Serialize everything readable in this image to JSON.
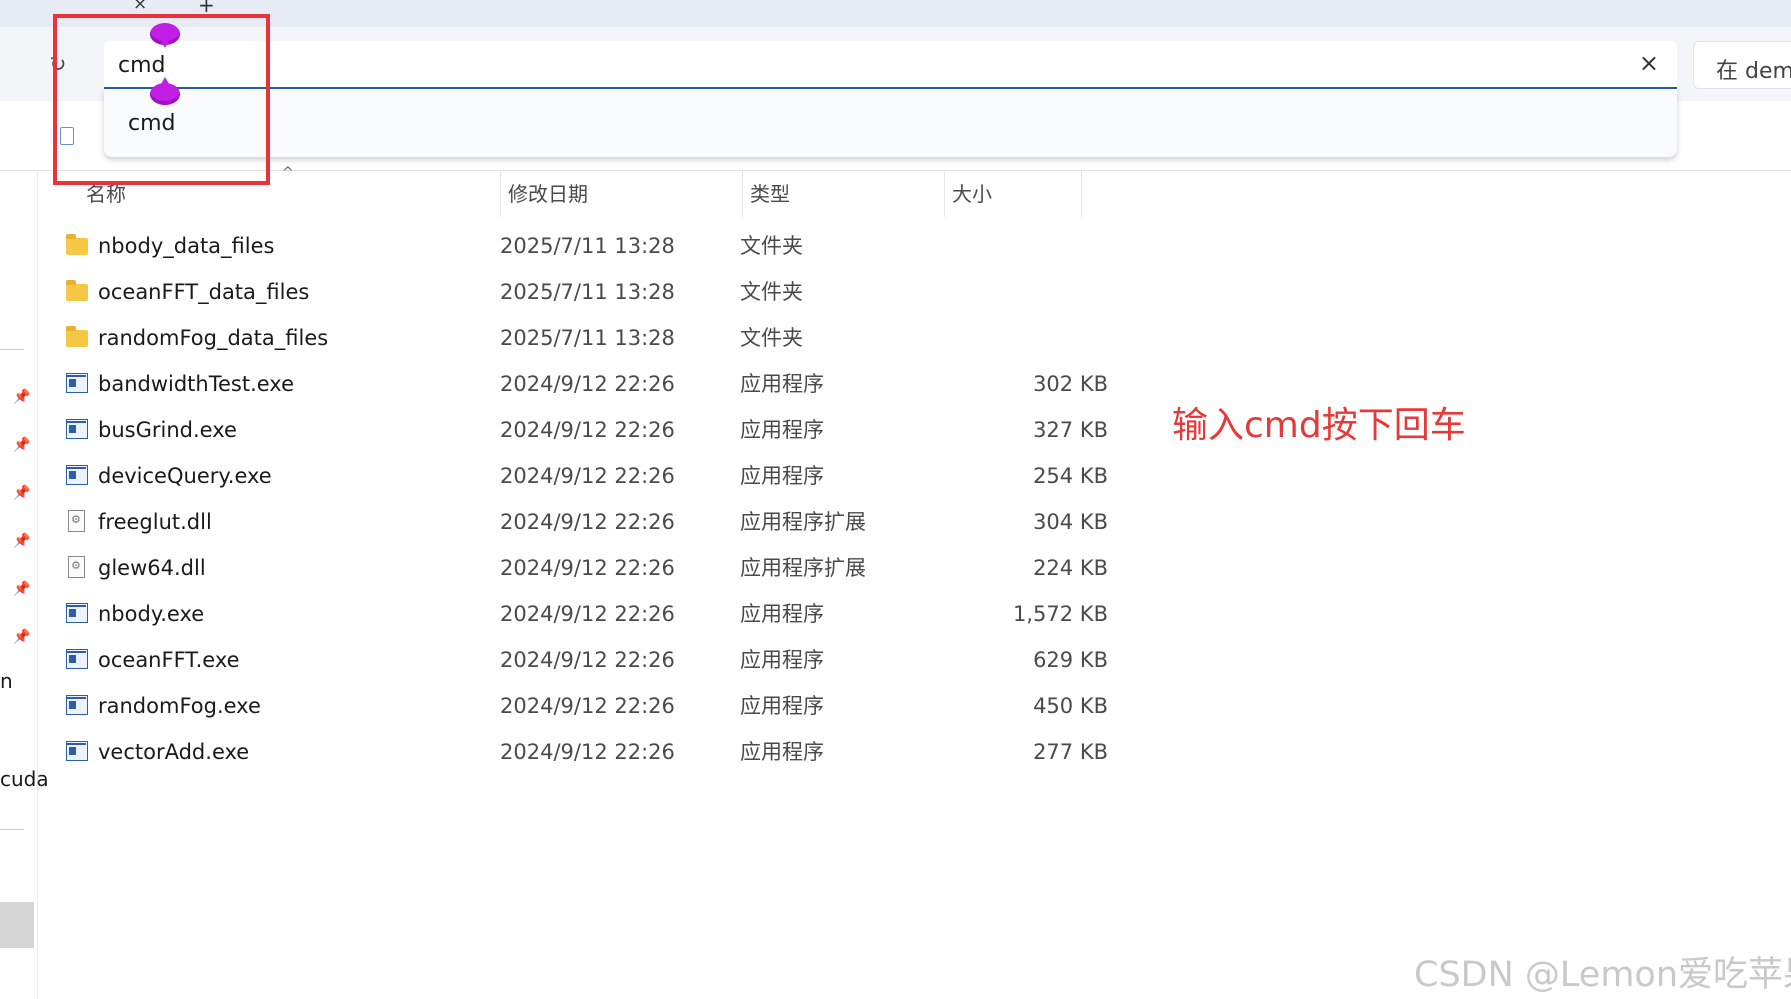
{
  "titlebar": {
    "close_glyph": "×",
    "add_glyph": "+"
  },
  "toolbar": {
    "refresh_glyph": "↻",
    "address_value": "cmd",
    "clear_glyph": "×",
    "search_placeholder": "在 dem"
  },
  "dropdown": {
    "items": [
      "cmd"
    ]
  },
  "columns": {
    "name": "名称",
    "date": "修改日期",
    "type": "类型",
    "size": "大小",
    "sort_glyph": "^"
  },
  "files": [
    {
      "icon": "folder-icon",
      "name": "nbody_data_files",
      "date": "2025/7/11 13:28",
      "type": "文件夹",
      "size": ""
    },
    {
      "icon": "folder-icon",
      "name": "oceanFFT_data_files",
      "date": "2025/7/11 13:28",
      "type": "文件夹",
      "size": ""
    },
    {
      "icon": "folder-icon",
      "name": "randomFog_data_files",
      "date": "2025/7/11 13:28",
      "type": "文件夹",
      "size": ""
    },
    {
      "icon": "exe-icon",
      "name": "bandwidthTest.exe",
      "date": "2024/9/12 22:26",
      "type": "应用程序",
      "size": "302 KB"
    },
    {
      "icon": "exe-icon",
      "name": "busGrind.exe",
      "date": "2024/9/12 22:26",
      "type": "应用程序",
      "size": "327 KB"
    },
    {
      "icon": "exe-icon",
      "name": "deviceQuery.exe",
      "date": "2024/9/12 22:26",
      "type": "应用程序",
      "size": "254 KB"
    },
    {
      "icon": "dll-icon",
      "name": "freeglut.dll",
      "date": "2024/9/12 22:26",
      "type": "应用程序扩展",
      "size": "304 KB"
    },
    {
      "icon": "dll-icon",
      "name": "glew64.dll",
      "date": "2024/9/12 22:26",
      "type": "应用程序扩展",
      "size": "224 KB"
    },
    {
      "icon": "exe-icon",
      "name": "nbody.exe",
      "date": "2024/9/12 22:26",
      "type": "应用程序",
      "size": "1,572 KB"
    },
    {
      "icon": "exe-icon",
      "name": "oceanFFT.exe",
      "date": "2024/9/12 22:26",
      "type": "应用程序",
      "size": "629 KB"
    },
    {
      "icon": "exe-icon",
      "name": "randomFog.exe",
      "date": "2024/9/12 22:26",
      "type": "应用程序",
      "size": "450 KB"
    },
    {
      "icon": "exe-icon",
      "name": "vectorAdd.exe",
      "date": "2024/9/12 22:26",
      "type": "应用程序",
      "size": "277 KB"
    }
  ],
  "sidebar": {
    "partial_text_1": "n",
    "partial_text_2": "cuda",
    "pin_glyph": "📌"
  },
  "annotation": {
    "note": "输入cmd按下回车",
    "highlight_color": "#e8333a",
    "marker_color": "#c21ee6"
  },
  "watermark": "CSDN @Lemon爱吃苹果"
}
